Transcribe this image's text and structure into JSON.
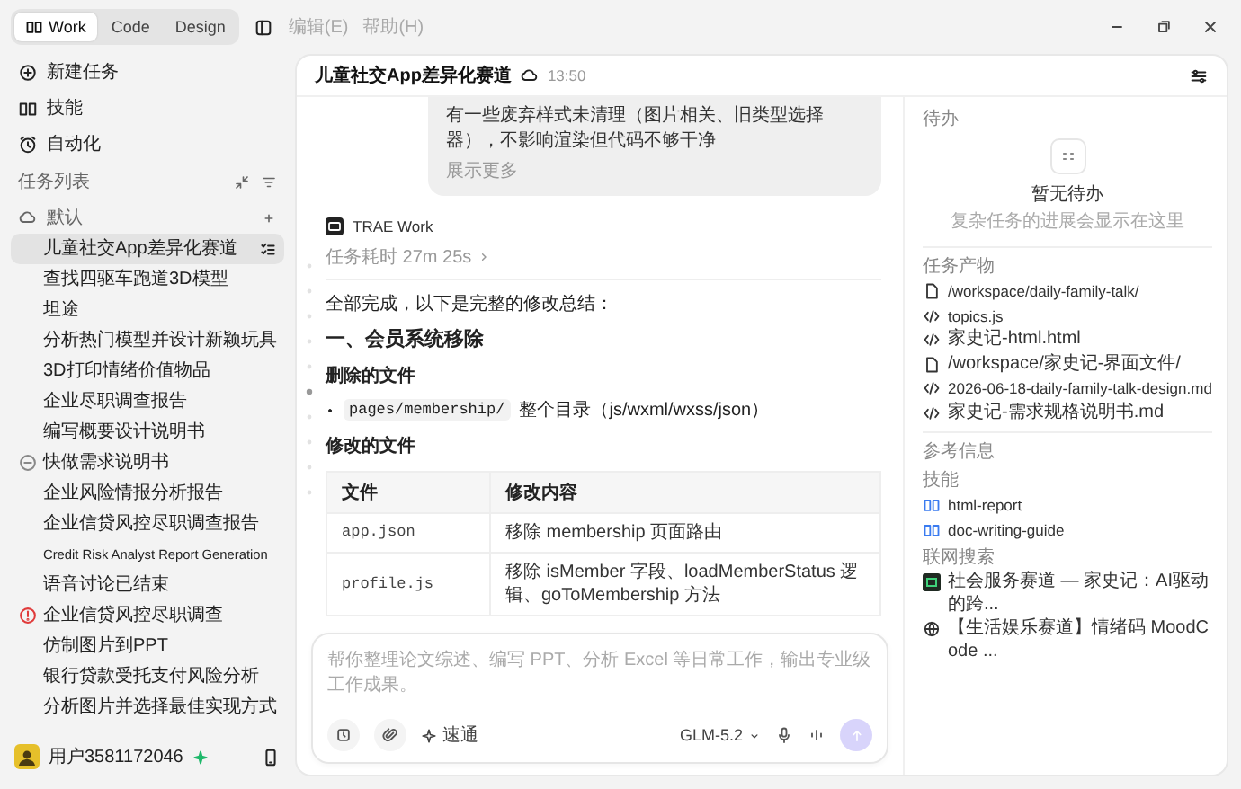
{
  "topbar": {
    "modes": [
      {
        "label": "Work",
        "selected": true
      },
      {
        "label": "Code",
        "selected": false
      },
      {
        "label": "Design",
        "selected": false
      }
    ],
    "menus": [
      {
        "label": "编辑(E)",
        "disabled": true
      },
      {
        "label": "帮助(H)",
        "disabled": true
      }
    ]
  },
  "sidebar": {
    "nav": [
      {
        "label": "新建任务"
      },
      {
        "label": "技能"
      },
      {
        "label": "自动化"
      }
    ],
    "section_title": "任务列表",
    "group": "默认",
    "tasks": [
      {
        "label": "儿童社交App差异化赛道",
        "selected": true,
        "kind": "plain"
      },
      {
        "label": "查找四驱车跑道3D模型",
        "selected": false,
        "kind": "plain"
      },
      {
        "label": "坦途",
        "selected": false,
        "kind": "plain"
      },
      {
        "label": "分析热门模型并设计新颖玩具",
        "selected": false,
        "kind": "plain"
      },
      {
        "label": "3D打印情绪价值物品",
        "selected": false,
        "kind": "plain"
      },
      {
        "label": "企业尽职调查报告",
        "selected": false,
        "kind": "plain"
      },
      {
        "label": "编写概要设计说明书",
        "selected": false,
        "kind": "plain"
      },
      {
        "label": "快做需求说明书",
        "selected": false,
        "kind": "pending"
      },
      {
        "label": "企业风险情报分析报告",
        "selected": false,
        "kind": "plain"
      },
      {
        "label": "企业信贷风控尽职调查报告",
        "selected": false,
        "kind": "plain"
      },
      {
        "label": "Credit Risk Analyst Report Generation",
        "selected": false,
        "kind": "plain"
      },
      {
        "label": "语音讨论已结束",
        "selected": false,
        "kind": "plain"
      },
      {
        "label": "企业信贷风控尽职调查",
        "selected": false,
        "kind": "alert"
      },
      {
        "label": "仿制图片到PPT",
        "selected": false,
        "kind": "plain"
      },
      {
        "label": "银行贷款受托支付风险分析",
        "selected": false,
        "kind": "plain"
      },
      {
        "label": "分析图片并选择最佳实现方式",
        "selected": false,
        "kind": "plain"
      }
    ],
    "user": {
      "name": "用户3581172046"
    }
  },
  "conversation": {
    "title": "儿童社交App差异化赛道",
    "time": "13:50",
    "user_message": {
      "text": "有一些废弃样式未清理（图片相关、旧类型选择器），不影响渲染但代码不够干净",
      "more": "展示更多"
    },
    "agent": {
      "name": "TRAE Work",
      "duration": "任务耗时 27m 25s",
      "summary": "全部完成，以下是完整的修改总结：",
      "heading": "一、会员系统移除",
      "deleted_heading": "删除的文件",
      "deleted": [
        {
          "path": "pages/membership/",
          "note": "整个目录（js/wxml/wxss/json）"
        }
      ],
      "modified_heading": "修改的文件",
      "table": {
        "columns": [
          "文件",
          "修改内容"
        ],
        "rows": [
          [
            "app.json",
            "移除 membership 页面路由"
          ],
          [
            "profile.js",
            "移除 isMember 字段、loadMemberStatus 逻辑、goToMembership 方法"
          ]
        ]
      }
    }
  },
  "composer": {
    "placeholder": "帮你整理论文综述、编写 PPT、分析 Excel 等日常工作，输出专业级工作成果。",
    "quick": "速通",
    "model": "GLM-5.2",
    "send_disabled": true
  },
  "panel": {
    "todo": {
      "title": "待办",
      "empty_title": "暂无待办",
      "empty_hint": "复杂任务的进展会显示在这里"
    },
    "outputs": {
      "title": "任务产物",
      "files": [
        {
          "kind": "folder",
          "name": "/workspace/daily-family-talk/"
        },
        {
          "kind": "code",
          "name": "topics.js"
        },
        {
          "kind": "code",
          "name": "家史记-html.html"
        },
        {
          "kind": "folder",
          "name": "/workspace/家史记-界面文件/"
        },
        {
          "kind": "code",
          "name": "2026-06-18-daily-family-talk-design.md"
        },
        {
          "kind": "code",
          "name": "家史记-需求规格说明书.md"
        }
      ]
    },
    "references": {
      "title": "参考信息",
      "skills_title": "技能",
      "skills": [
        "html-report",
        "doc-writing-guide"
      ],
      "search_title": "联网搜索",
      "results": [
        {
          "kind": "site",
          "title": "社会服务赛道 — 家史记：AI驱动的跨..."
        },
        {
          "kind": "web",
          "title": "【生活娱乐赛道】情绪码 MoodCode ..."
        }
      ]
    }
  }
}
